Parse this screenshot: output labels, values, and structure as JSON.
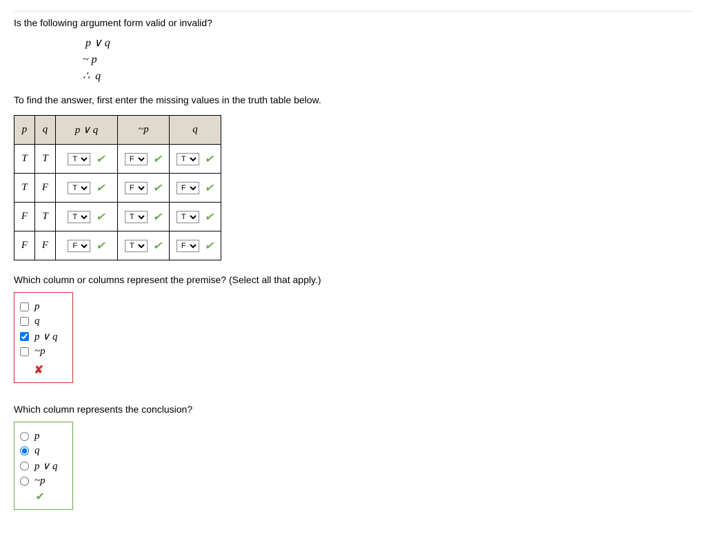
{
  "question": "Is the following argument form valid or invalid?",
  "argument": {
    "line1": " p ∨ q",
    "line2": "~ p",
    "line3": "∴  q"
  },
  "instruction": "To find the answer, first enter the missing values in the truth table below.",
  "table": {
    "headers": {
      "p": "p",
      "q": "q",
      "pvq": "p ∨ q",
      "np": "~p",
      "qc": "q"
    },
    "rows": [
      {
        "p": "T",
        "q": "T",
        "pvq": "T",
        "np": "F",
        "qc": "T"
      },
      {
        "p": "T",
        "q": "F",
        "pvq": "T",
        "np": "F",
        "qc": "F"
      },
      {
        "p": "F",
        "q": "T",
        "pvq": "T",
        "np": "T",
        "qc": "T"
      },
      {
        "p": "F",
        "q": "F",
        "pvq": "F",
        "np": "T",
        "qc": "F"
      }
    ]
  },
  "premise_q": "Which column or columns represent the premise? (Select all that apply.)",
  "premise_opts": {
    "p": "p",
    "q": "q",
    "pvq": "p ∨ q",
    "np": "~p"
  },
  "conclusion_q": "Which column represents the conclusion?",
  "conclusion_opts": {
    "p": "p",
    "q": "q",
    "pvq": "p ∨ q",
    "np": "~p"
  }
}
